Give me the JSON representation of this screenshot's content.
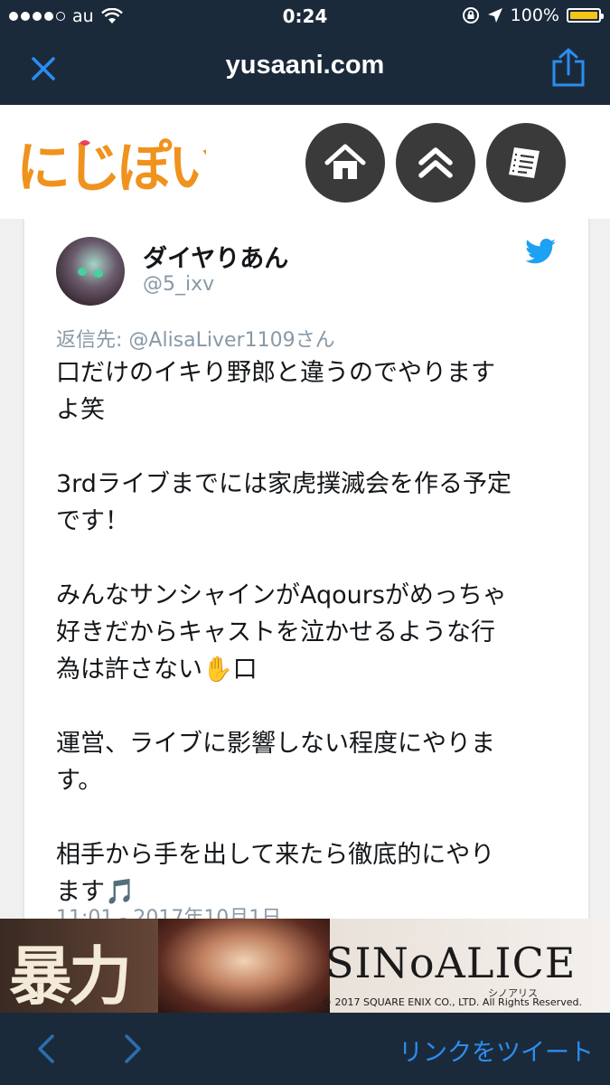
{
  "status_bar": {
    "carrier": "au",
    "time": "0:24",
    "battery": "100%"
  },
  "nav": {
    "title": "yusaani.com"
  },
  "site": {
    "logo_text": "にじぽい"
  },
  "tweet": {
    "display_name": "ダイヤりあん",
    "handle": "@5_ixv",
    "reply_to": "返信先: @AlisaLiver1109さん",
    "body": "口だけのイキり野郎と違うのでやります\nよ笑\n\n3rdライブまでには家虎撲滅会を作る予定\nです！\n\nみんなサンシャインがAqoursがめっちゃ\n好きだからキャストを泣かせるような行\n為は許さない✋口\n\n運営、ライブに影響しない程度にやりま\nす。\n\n相手から手を出して来たら徹底的にやり\nます🎵",
    "timestamp": "11:01 - 2017年10月1日"
  },
  "ad": {
    "kanji": "暴力",
    "title": "SINoALICE",
    "subtitle": "シノアリス",
    "copyright": "© 2017 SQUARE ENIX CO., LTD. All Rights Reserved."
  },
  "toolbar": {
    "tweet_link_label": "リンクをツイート"
  },
  "colors": {
    "bar_bg": "#1b2a3a",
    "accent_blue": "#2a8ef0",
    "twitter_blue": "#1da1f2",
    "battery": "#f5c518"
  }
}
